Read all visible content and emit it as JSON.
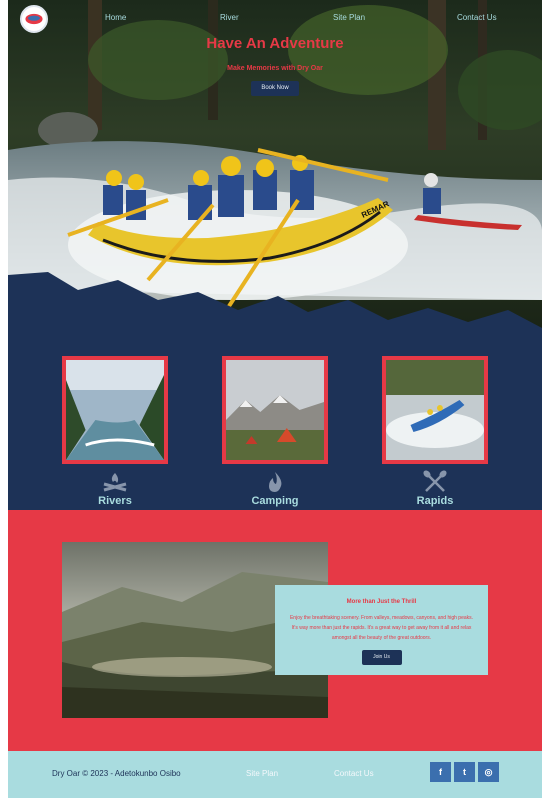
{
  "nav": {
    "items": [
      {
        "label": "Home"
      },
      {
        "label": "River"
      },
      {
        "label": "Site Plan"
      },
      {
        "label": "Contact Us"
      }
    ]
  },
  "hero": {
    "title": "Have An Adventure",
    "subtitle": "Make Memories with Dry Oar",
    "button": "Book Now",
    "raft_text": "REMAR"
  },
  "features": [
    {
      "label": "Rivers",
      "icon": "campfire-icon"
    },
    {
      "label": "Camping",
      "icon": "flame-icon"
    },
    {
      "label": "Rapids",
      "icon": "crossed-paddles-icon"
    }
  ],
  "promo": {
    "title": "More than Just the Thrill",
    "body": "Enjoy the breathtaking scenery. From valleys, meadows, canyons, and high peaks. It's way more than just the rapids. It's a great way to get away from it all and relax amongst all the beauty of the great outdoors.",
    "button": "Join Us"
  },
  "footer": {
    "copyright": "Dry Oar © 2023 - Adetokunbo Osibo",
    "links": [
      {
        "label": "Site Plan"
      },
      {
        "label": "Contact Us"
      }
    ],
    "social": [
      {
        "icon": "facebook-icon",
        "glyph": "f"
      },
      {
        "icon": "twitter-icon",
        "glyph": "t"
      },
      {
        "icon": "instagram-icon",
        "glyph": "◎"
      }
    ]
  },
  "colors": {
    "navy": "#1d3257",
    "red": "#e63946",
    "aqua": "#a9dcdf",
    "social_blue": "#3b6fae"
  }
}
